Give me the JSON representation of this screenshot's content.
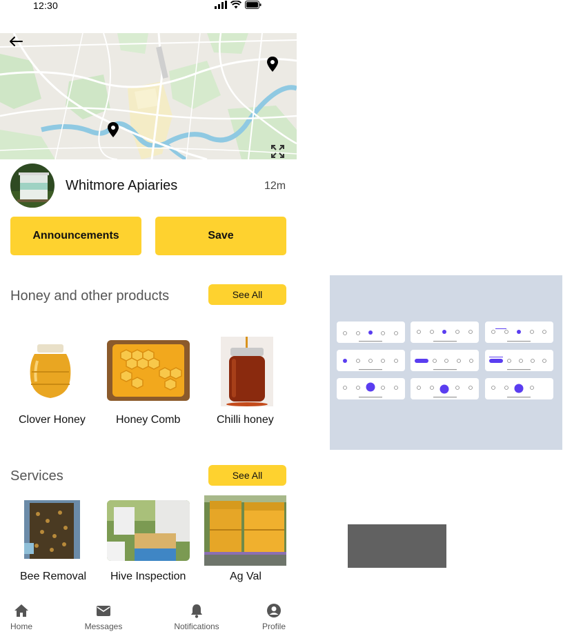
{
  "status_bar": {
    "time": "12:30"
  },
  "header": {
    "back_icon": "arrow-left-icon",
    "expand_icon": "expand-icon"
  },
  "business": {
    "name": "Whitmore Apiaries",
    "distance": "12m"
  },
  "actions": {
    "announcements_label": "Announcements",
    "save_label": "Save"
  },
  "products": {
    "title": "Honey and other products",
    "see_all_label": "See All",
    "items": [
      {
        "label": "Clover Honey"
      },
      {
        "label": "Honey Comb"
      },
      {
        "label": "Chilli honey"
      }
    ]
  },
  "services": {
    "title": "Services",
    "see_all_label": "See All",
    "items": [
      {
        "label": "Bee Removal"
      },
      {
        "label": "Hive Inspection"
      },
      {
        "label": "Ag Val"
      }
    ]
  },
  "bottom_nav": {
    "items": [
      {
        "label": "Home",
        "icon": "home-icon"
      },
      {
        "label": "Messages",
        "icon": "envelope-icon"
      },
      {
        "label": "Notifications",
        "icon": "bell-icon"
      },
      {
        "label": "Profile",
        "icon": "user-circle-icon"
      }
    ]
  },
  "colors": {
    "accent": "#fed22f",
    "artboard": "#d1d9e5",
    "gray_block": "#616161"
  }
}
